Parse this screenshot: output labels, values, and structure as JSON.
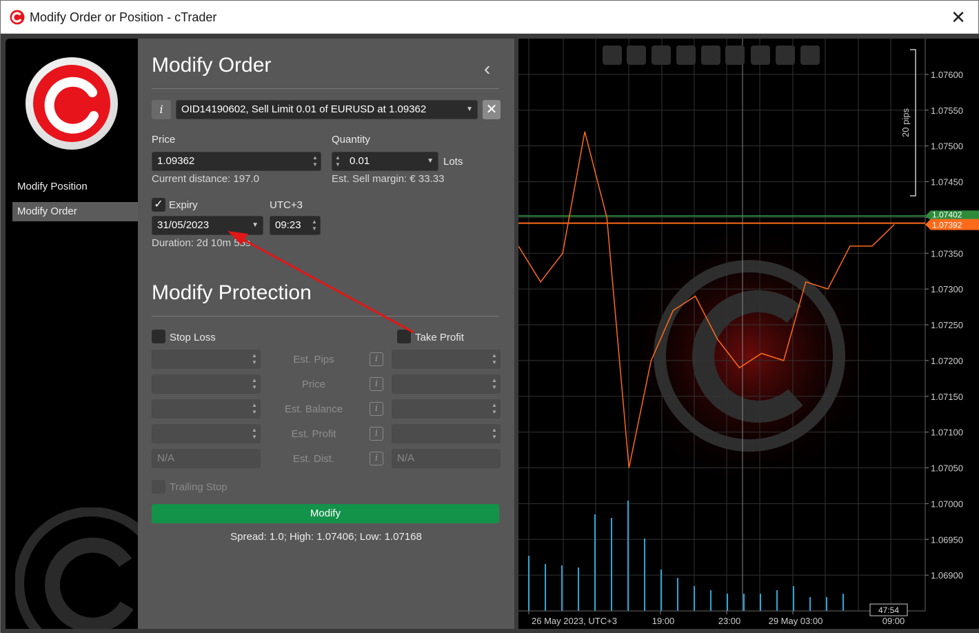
{
  "window": {
    "title": "Modify Order or Position - cTrader",
    "close_label": "✕"
  },
  "sidebar": {
    "items": [
      {
        "label": "Modify Position"
      },
      {
        "label": "Modify Order"
      }
    ]
  },
  "order": {
    "heading": "Modify Order",
    "collapse_label": "‹",
    "info_label": "i",
    "selector_value": "OID14190602, Sell Limit 0.01 of EURUSD at 1.09362",
    "price_label": "Price",
    "price_value": "1.09362",
    "current_distance": "Current distance: 197.0",
    "quantity_label": "Quantity",
    "quantity_value": "0.01",
    "quantity_unit": "Lots",
    "sell_margin": "Est. Sell margin: € 33.33",
    "expiry_label": "Expiry",
    "timezone_label": "UTC+3",
    "expiry_date": "31/05/2023",
    "expiry_time": "09:23",
    "duration": "Duration: 2d 10m 55s"
  },
  "protection": {
    "heading": "Modify Protection",
    "stop_loss_label": "Stop Loss",
    "take_profit_label": "Take Profit",
    "rows": [
      "Est. Pips",
      "Price",
      "Est. Balance",
      "Est. Profit",
      "Est. Dist."
    ],
    "na_left": "N/A",
    "na_right": "N/A",
    "trailing_stop_label": "Trailing Stop",
    "modify_label": "Modify",
    "spread_info": "Spread: 1.0; High: 1.07406; Low: 1.07168"
  },
  "chart": {
    "toolbar_icons": [
      "zoom-out-icon",
      "zoom-in-icon",
      "chart-settings-icon",
      "indicator-icon",
      "timeframe-h1-icon",
      "list-icon",
      "facebook-icon",
      "sentiment-icon",
      "share-icon"
    ],
    "pips_label": "20 pips",
    "bid_tag": "1.07402",
    "ask_tag": "1.07392",
    "countdown": "47:54",
    "colors": {
      "line": "#ff6a1a",
      "bid": "#2e8b3a",
      "ask": "#ff6a1a",
      "volume": "#2ba8d8"
    }
  },
  "chart_data": {
    "type": "line",
    "title": "",
    "x": [
      "26 May 2023, UTC+3",
      "19:00",
      "23:00",
      "29 May 03:00",
      "09:00"
    ],
    "y_ticks": [
      "1.07600",
      "1.07550",
      "1.07500",
      "1.07450",
      "1.07400",
      "1.07350",
      "1.07300",
      "1.07250",
      "1.07200",
      "1.07150",
      "1.07100",
      "1.07050",
      "1.07000",
      "1.06950",
      "1.06900"
    ],
    "ylim": [
      1.0685,
      1.0765
    ],
    "series": [
      {
        "values": [
          1.0736,
          1.0731,
          1.0735,
          1.0752,
          1.074,
          1.0705,
          1.072,
          1.0727,
          1.0729,
          1.0723,
          1.0719,
          1.0721,
          1.072,
          1.0731,
          1.073,
          1.0736,
          1.0736,
          1.0739
        ]
      }
    ],
    "volume": [
      80,
      68,
      66,
      63,
      140,
      135,
      160,
      105,
      60,
      48,
      36,
      30,
      25,
      25,
      25,
      30,
      36,
      20,
      20,
      25
    ]
  }
}
